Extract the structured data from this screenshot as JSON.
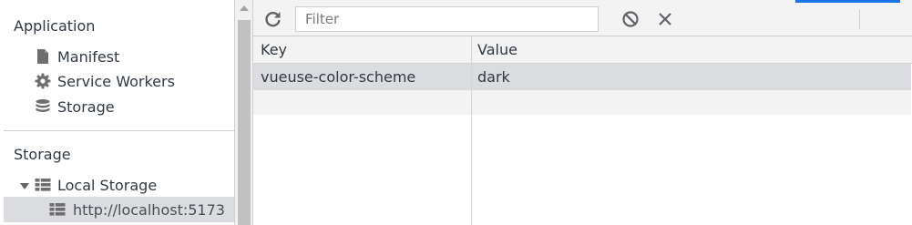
{
  "sidebar": {
    "application": {
      "title": "Application",
      "items": [
        {
          "label": "Manifest",
          "icon": "document-icon"
        },
        {
          "label": "Service Workers",
          "icon": "gear-icon"
        },
        {
          "label": "Storage",
          "icon": "database-icon"
        }
      ]
    },
    "storage": {
      "title": "Storage",
      "local_storage": {
        "label": "Local Storage",
        "icon": "table-grid-icon",
        "expanded": true
      },
      "origin": {
        "label": "http://localhost:5173",
        "icon": "table-grid-icon",
        "selected": true
      }
    }
  },
  "toolbar": {
    "refresh_icon": "refresh-icon",
    "filter": {
      "placeholder": "Filter",
      "value": ""
    },
    "clear_all_icon": "block-icon",
    "delete_icon": "close-icon",
    "accent_color": "#1a73e8"
  },
  "table": {
    "columns": [
      "Key",
      "Value"
    ],
    "rows": [
      {
        "key": "vueuse-color-scheme",
        "value": "dark"
      }
    ],
    "selected_row_color": "#dadce0"
  }
}
